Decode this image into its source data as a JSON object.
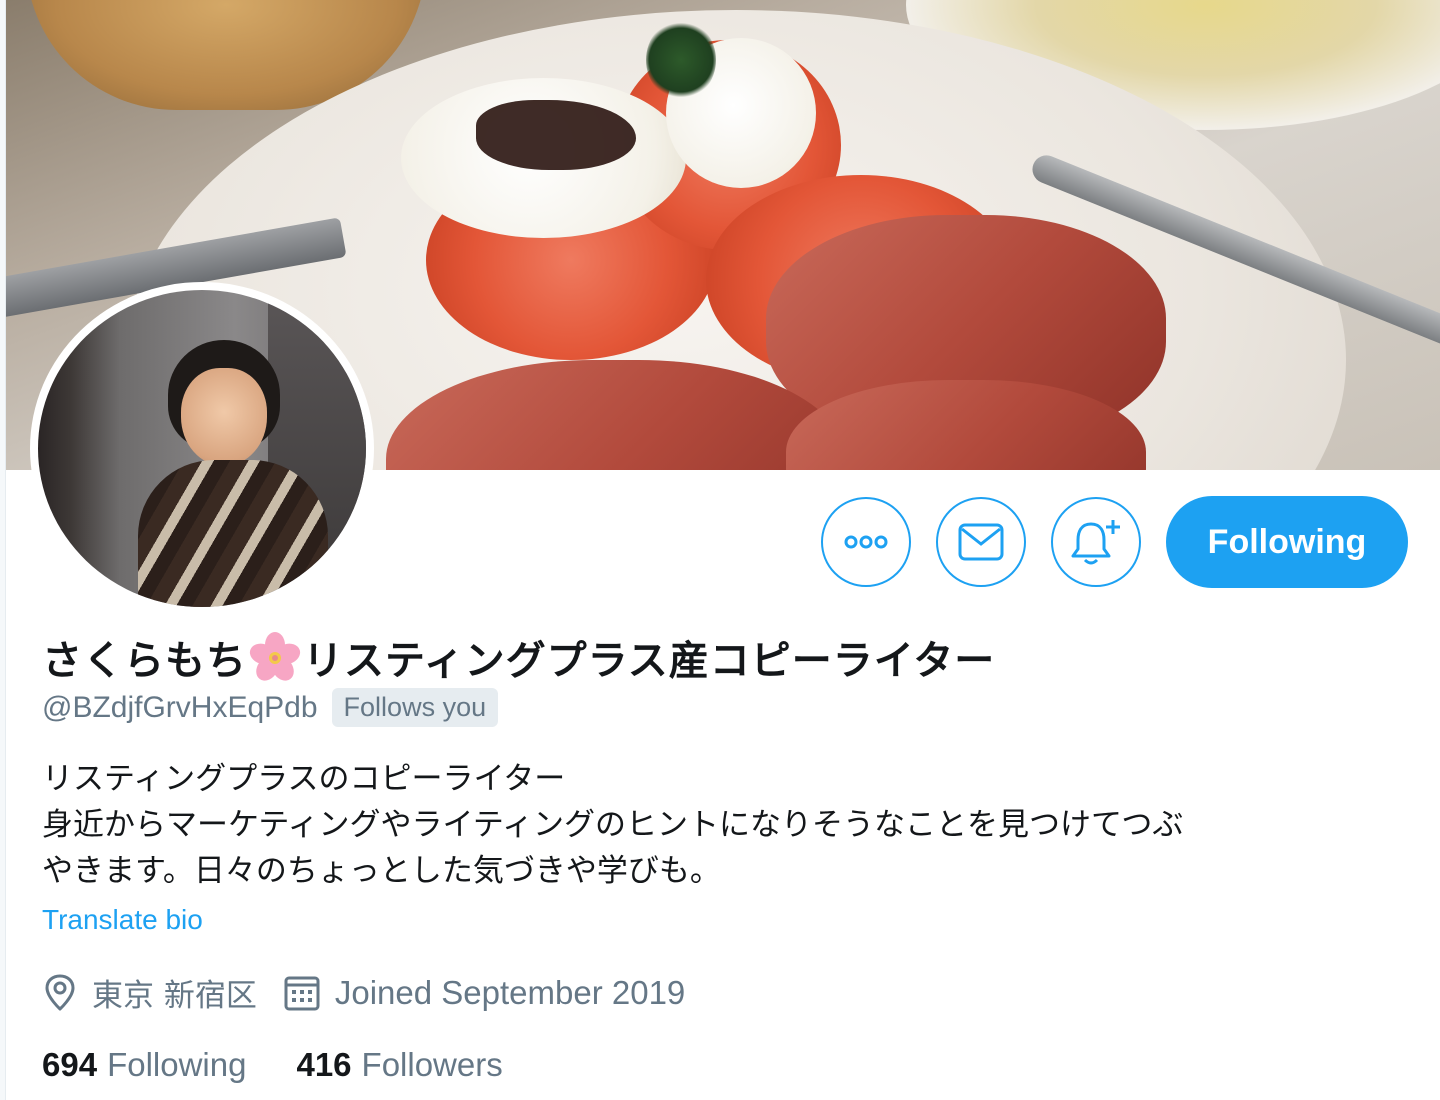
{
  "profile": {
    "display_name_before": "さくらもち",
    "display_name_after": "リスティングプラス産コピーライター",
    "handle": "@BZdjfGrvHxEqPdb",
    "follows_you": "Follows you",
    "bio_lines": [
      "リスティングプラスのコピーライター",
      "身近からマーケティングやライティングのヒントになりそうなことを見つけてつぶ",
      "やきます。日々のちょっとした気づきや学びも。"
    ],
    "translate_bio": "Translate bio",
    "location": "東京 新宿区",
    "joined": "Joined September 2019",
    "following_count": "694",
    "following_label": "Following",
    "followers_count": "416",
    "followers_label": "Followers"
  },
  "actions": {
    "more_icon": "more-icon",
    "message_icon": "envelope-icon",
    "notify_icon": "bell-plus-icon",
    "follow_button": "Following"
  },
  "colors": {
    "accent": "#1da1f2",
    "secondary_text": "#657786",
    "primary_text": "#14171a",
    "badge_bg": "#e6ecf0"
  }
}
